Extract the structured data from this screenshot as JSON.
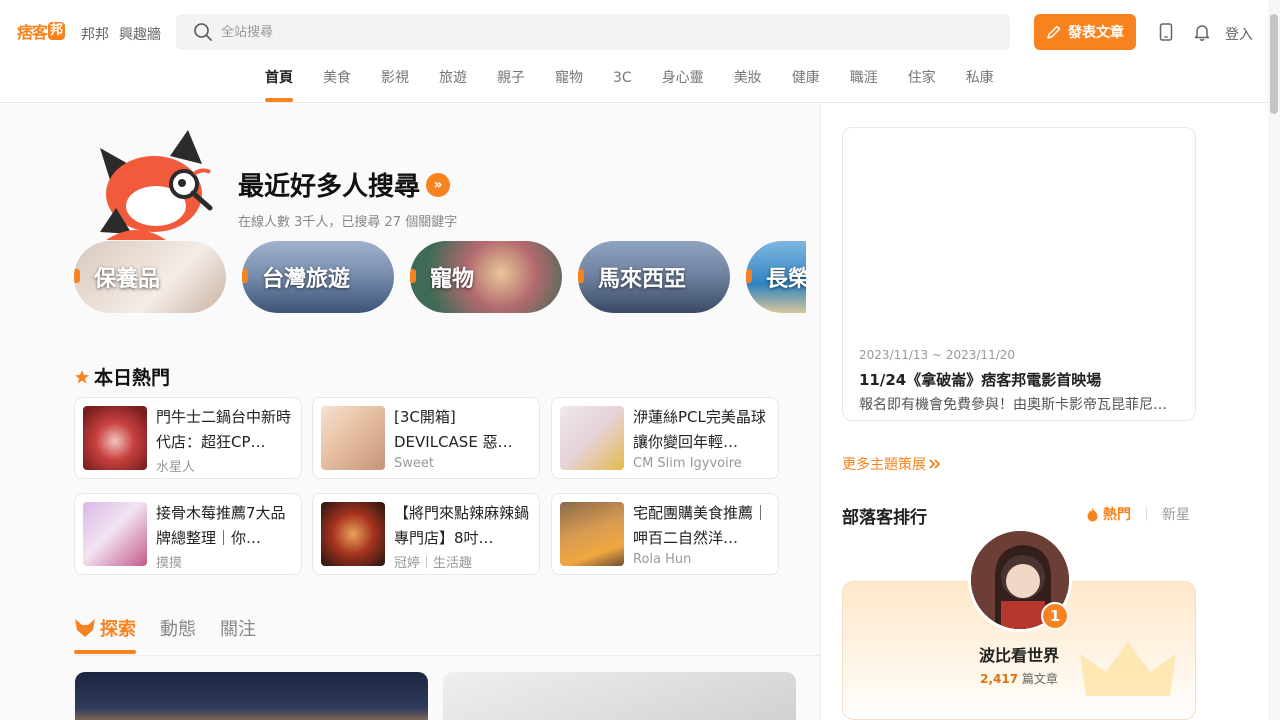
{
  "header": {
    "logo_text": "痞客",
    "logo_box": "邦",
    "links": [
      "邦邦",
      "興趣牆"
    ],
    "search_placeholder": "全站搜尋",
    "post_button": "發表文章",
    "login": "登入"
  },
  "nav_tabs": [
    "首頁",
    "美食",
    "影視",
    "旅遊",
    "親子",
    "寵物",
    "3C",
    "身心靈",
    "美妝",
    "健康",
    "職涯",
    "住家",
    "私康"
  ],
  "trending": {
    "title": "最近好多人搜尋",
    "arrow": "»",
    "subtitle": "在線人數 3千人，已搜尋 27 個關鍵字",
    "pills": [
      "保養品",
      "台灣旅遊",
      "寵物",
      "馬來西亞",
      "長榮"
    ]
  },
  "hot_today": {
    "title": "本日熱門",
    "cards": [
      {
        "title": "門牛士二鍋台中新時代店：超狂CP…",
        "meta": "水星人"
      },
      {
        "title": "[3C開箱] DEVILCASE 惡…",
        "meta": "Sweet"
      },
      {
        "title": "洢蓮絲PCL完美晶球讓你變回年輕…",
        "meta": "CM Slim Igyvoire"
      },
      {
        "title": "接骨木莓推薦7大品牌總整理｜你…",
        "meta": "摸摸"
      },
      {
        "title": "【將門來點辣麻辣鍋專門店】8吋…",
        "meta": "冠婷｜生活趣"
      },
      {
        "title": "宅配團購美食推薦｜呷百二自然洋…",
        "meta": "Rola Hun"
      }
    ]
  },
  "feed_tabs": [
    "探索",
    "動態",
    "關注"
  ],
  "event": {
    "date": "2023/11/13 ~ 2023/11/20",
    "title": "11/24《拿破崙》痞客邦電影首映場",
    "desc": "報名即有機會免費參與！由奧斯卡影帝瓦昆菲尼…"
  },
  "more_link": "更多主題策展",
  "ranking": {
    "title": "部落客排行",
    "tab_hot": "熱門",
    "tab_new": "新星",
    "rank": "1",
    "name": "波比看世界",
    "count": "2,417",
    "count_unit": "篇文章"
  },
  "colors": {
    "accent": "#f7821e"
  }
}
